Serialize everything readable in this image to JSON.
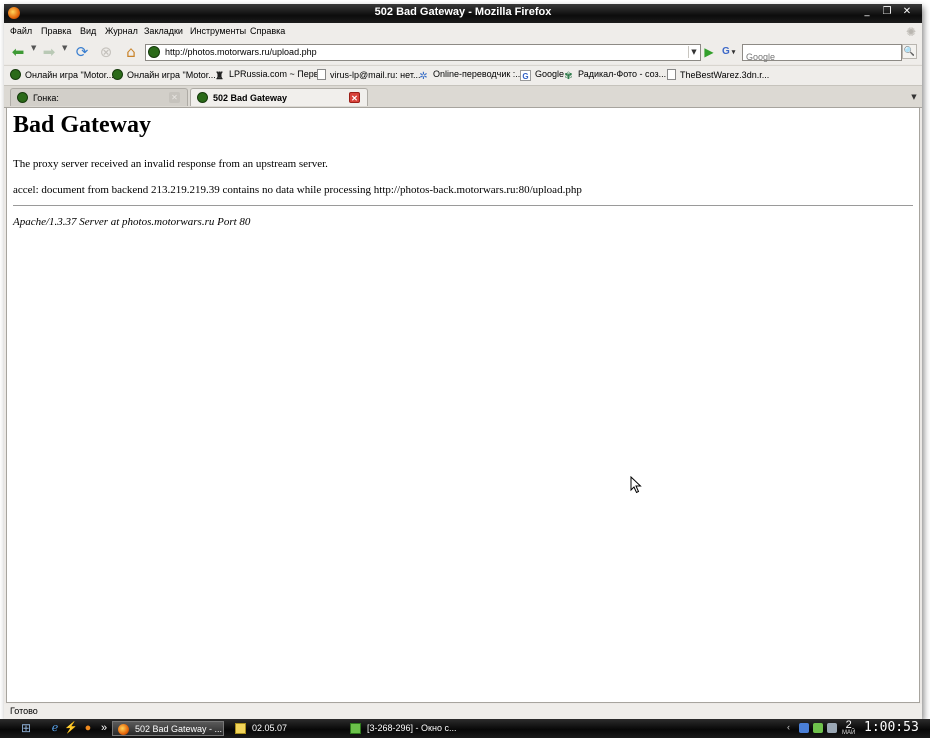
{
  "window": {
    "title": "502 Bad Gateway - Mozilla Firefox",
    "controls": {
      "minimize": "_",
      "maximize": "❐",
      "close": "✕"
    }
  },
  "menu": {
    "items": [
      "Файл",
      "Правка",
      "Вид",
      "Журнал",
      "Закладки",
      "Инструменты",
      "Справка"
    ]
  },
  "navbar": {
    "url": "http://photos.motorwars.ru/upload.php",
    "search_placeholder": "Google",
    "search_engine": "G"
  },
  "bookmarks": {
    "items": [
      {
        "label": "Онлайн игра \"Motor...",
        "icon": "motorwars-icon"
      },
      {
        "label": "Онлайн игра \"Motor...",
        "icon": "motorwars-icon"
      },
      {
        "label": "LPRussia.com ~ Перв...",
        "icon": "lpr-icon"
      },
      {
        "label": "virus-lp@mail.ru: нет...",
        "icon": "page-icon"
      },
      {
        "label": "Online-переводчик :...",
        "icon": "translate-icon"
      },
      {
        "label": "Google",
        "icon": "google-icon"
      },
      {
        "label": "Радикал-Фото - соз...",
        "icon": "radikal-icon"
      },
      {
        "label": "TheBestWarez.3dn.r...",
        "icon": "page-icon"
      }
    ]
  },
  "tabs": [
    {
      "label": "Гонка:",
      "active": false
    },
    {
      "label": "502 Bad Gateway",
      "active": true
    }
  ],
  "page": {
    "heading": "Bad Gateway",
    "paragraph1": "The proxy server received an invalid response from an upstream server.",
    "paragraph2": "accel: document from backend 213.219.219.39 contains no data while processing http://photos-back.motorwars.ru:80/upload.php",
    "address": "Apache/1.3.37 Server at photos.motorwars.ru Port 80"
  },
  "status": {
    "text": "Готово"
  },
  "taskbar": {
    "quicklaunch_more": "»",
    "tasks": [
      {
        "label": "502 Bad Gateway - ...",
        "active": true
      },
      {
        "label": "02.05.07",
        "active": false
      },
      {
        "label": "[3-268-296] - Окно с...",
        "active": false
      }
    ],
    "tray_arrow": "‹",
    "lang_day": "2",
    "lang_month": "МАЙ",
    "clock": "1:00:53"
  },
  "colors": {
    "titlebar": "#0c0c0c",
    "chrome": "#efedea",
    "tab_close_active": "#d8423a",
    "go_button": "#33a02c",
    "taskbar": "#080808"
  }
}
